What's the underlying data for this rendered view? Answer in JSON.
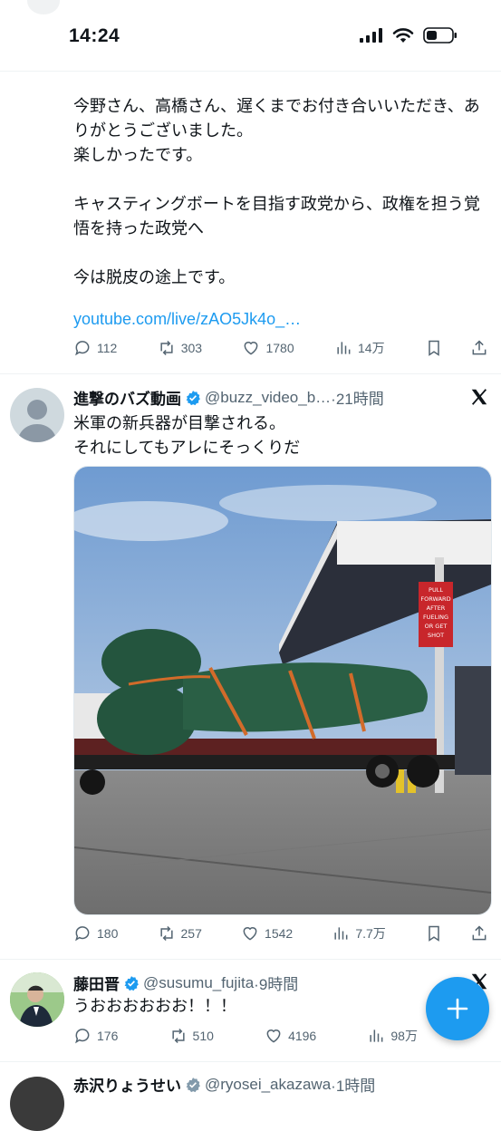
{
  "status_bar": {
    "time": "14:24"
  },
  "tweet1": {
    "text": "今野さん、高橋さん、遅くまでお付き合いいただき、ありがとうございました。\n楽しかったです。\n\nキャスティングボートを目指す政党から、政権を担う覚悟を持った政党へ\n\n今は脱皮の途上です。",
    "link": "youtube.com/live/zAO5Jk4o_…",
    "replies": "112",
    "reposts": "303",
    "likes": "1780",
    "views": "14万"
  },
  "tweet2": {
    "name": "進撃のバズ動画",
    "handle": "@buzz_video_b…",
    "time": "·21時間",
    "text": "米軍の新兵器が目撃される。\nそれにしてもアレにそっくりだ",
    "sign_text": "PULL FORWARD AFTER FUELING OR GET SHOT",
    "replies": "180",
    "reposts": "257",
    "likes": "1542",
    "views": "7.7万"
  },
  "tweet3": {
    "name": "藤田晋",
    "handle": "@susumu_fujita",
    "time": "·9時間",
    "text": "うおおおおおお！！！",
    "replies": "176",
    "reposts": "510",
    "likes": "4196",
    "views": "98万"
  },
  "tweet4": {
    "name": "赤沢りょうせい",
    "handle": "@ryosei_akazawa",
    "time": "·1時間"
  },
  "colors": {
    "accent": "#1d9bf0",
    "muted": "#536471",
    "text": "#0f1419"
  },
  "icons": [
    "reply-icon",
    "repost-icon",
    "like-icon",
    "views-icon",
    "bookmark-icon",
    "share-icon",
    "verified-icon",
    "x-logo-icon",
    "compose-plus-icon",
    "signal-icon",
    "wifi-icon",
    "battery-icon"
  ]
}
